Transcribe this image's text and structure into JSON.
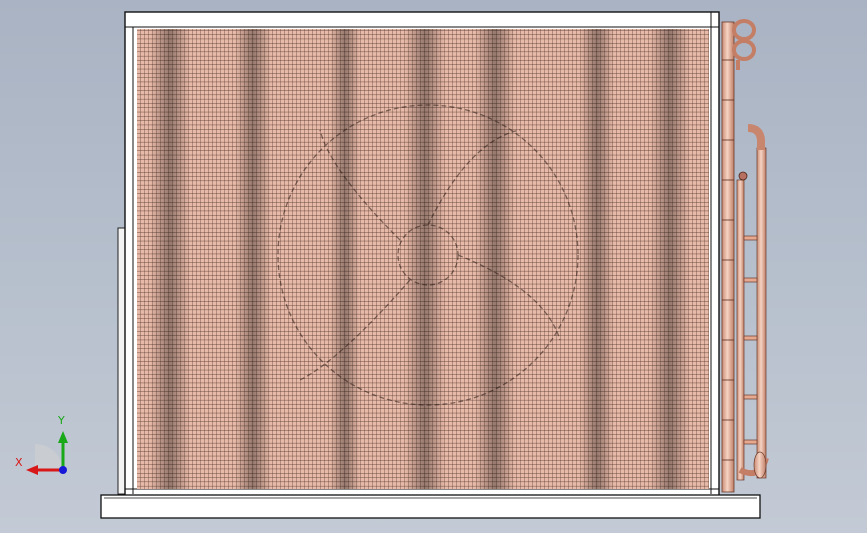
{
  "viewport": {
    "background_top": "#a9b3c3",
    "background_bottom": "#c3cad5"
  },
  "model": {
    "component": "condenser-coil",
    "coil_fill_color": "#e7b9a8",
    "fin_line_color": "#2a1a14",
    "copper_tube_color": "#e9b39a",
    "frame_color": "#ffffff",
    "outline_color": "#1a1a1a"
  },
  "triad": {
    "x_label": "X",
    "y_label": "Y",
    "x_color": "#d81818",
    "y_color": "#18a818",
    "z_color": "#1818d8"
  }
}
